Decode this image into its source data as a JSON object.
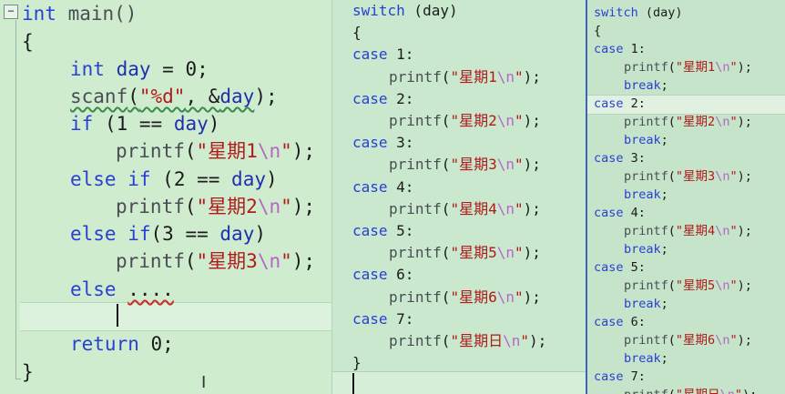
{
  "left": {
    "collapse_symbol": "−",
    "lines": [
      [
        "int",
        " main()"
      ],
      [
        "{"
      ],
      [
        "int",
        " day",
        " = ",
        "0",
        ";"
      ],
      [
        "scanf",
        "(",
        "\"%d\"",
        ", &",
        "day",
        ");"
      ],
      [
        "if",
        " (",
        "1",
        " == ",
        "day",
        ")"
      ],
      [
        "printf",
        "(",
        "\"星期1",
        "\\n",
        "\"",
        ");"
      ],
      [
        "else if",
        " (",
        "2",
        " == ",
        "day",
        ")"
      ],
      [
        "printf",
        "(",
        "\"星期2",
        "\\n",
        "\"",
        ");"
      ],
      [
        "else if",
        "(",
        "3",
        " == ",
        "day",
        ")"
      ],
      [
        "printf",
        "(",
        "\"星期3",
        "\\n",
        "\"",
        ");"
      ],
      [
        "else",
        " ",
        "...."
      ],
      [
        ""
      ],
      [
        "return",
        " ",
        "0",
        ";"
      ],
      [
        "}"
      ]
    ]
  },
  "middle": {
    "lines": [
      [
        "switch",
        " (day)"
      ],
      [
        "{"
      ],
      [
        "case",
        " 1:"
      ],
      [
        "printf",
        "(",
        "\"星期1",
        "\\n",
        "\"",
        ");"
      ],
      [
        "case",
        " 2:"
      ],
      [
        "printf",
        "(",
        "\"星期2",
        "\\n",
        "\"",
        ");"
      ],
      [
        "case",
        " 3:"
      ],
      [
        "printf",
        "(",
        "\"星期3",
        "\\n",
        "\"",
        ");"
      ],
      [
        "case",
        " 4:"
      ],
      [
        "printf",
        "(",
        "\"星期4",
        "\\n",
        "\"",
        ");"
      ],
      [
        "case",
        " 5:"
      ],
      [
        "printf",
        "(",
        "\"星期5",
        "\\n",
        "\"",
        ");"
      ],
      [
        "case",
        " 6:"
      ],
      [
        "printf",
        "(",
        "\"星期6",
        "\\n",
        "\"",
        ");"
      ],
      [
        "case",
        " 7:"
      ],
      [
        "printf",
        "(",
        "\"星期日",
        "\\n",
        "\"",
        ");"
      ],
      [
        "}"
      ]
    ]
  },
  "right": {
    "lines": [
      [
        "switch",
        " (day)"
      ],
      [
        "{"
      ],
      [
        "case",
        " 1:"
      ],
      [
        "printf",
        "(",
        "\"星期1",
        "\\n",
        "\"",
        ");"
      ],
      [
        "break",
        ";"
      ],
      [
        "case",
        " 2:"
      ],
      [
        "printf",
        "(",
        "\"星期2",
        "\\n",
        "\"",
        ");"
      ],
      [
        "break",
        ";"
      ],
      [
        "case",
        " 3:"
      ],
      [
        "printf",
        "(",
        "\"星期3",
        "\\n",
        "\"",
        ");"
      ],
      [
        "break",
        ";"
      ],
      [
        "case",
        " 4:"
      ],
      [
        "printf",
        "(",
        "\"星期4",
        "\\n",
        "\"",
        ");"
      ],
      [
        "break",
        ";"
      ],
      [
        "case",
        " 5:"
      ],
      [
        "printf",
        "(",
        "\"星期5",
        "\\n",
        "\"",
        ");"
      ],
      [
        "break",
        ";"
      ],
      [
        "case",
        " 6:"
      ],
      [
        "printf",
        "(",
        "\"星期6",
        "\\n",
        "\"",
        ");"
      ],
      [
        "break",
        ";"
      ],
      [
        "case",
        " 7:"
      ],
      [
        "printf",
        "(",
        "\"星期日",
        "\\n",
        "\"",
        ");"
      ]
    ]
  }
}
